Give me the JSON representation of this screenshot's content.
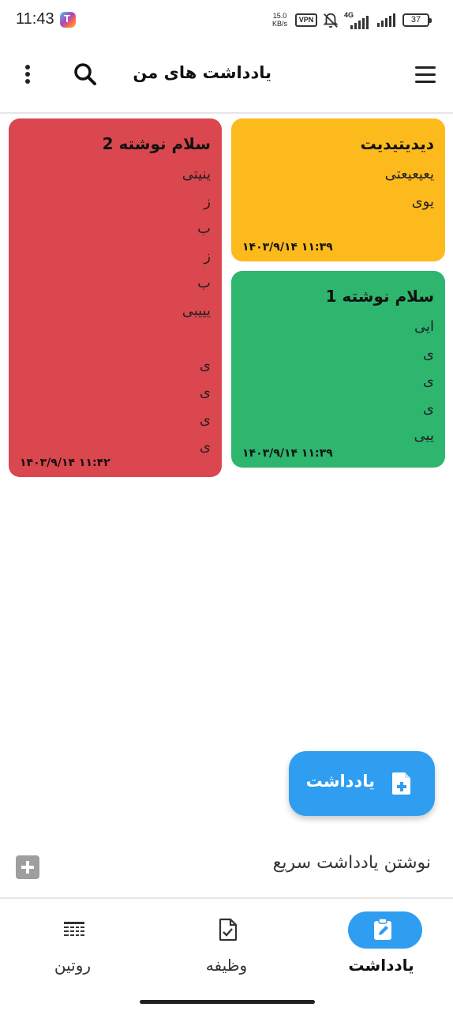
{
  "status_bar": {
    "time": "11:43",
    "net_speed_value": "15.0",
    "net_speed_unit": "KB/s",
    "vpn": "VPN",
    "network": "4G",
    "battery": "37"
  },
  "app_bar": {
    "title": "یادداشت های من",
    "icons": [
      "menu-icon",
      "search-icon",
      "more-vert-icon"
    ]
  },
  "notes": [
    {
      "title": "سلام نوشته 2",
      "lines": [
        "ینیتی",
        "ز",
        "ب",
        "ز",
        "ب",
        "یییبی",
        "",
        "ی",
        "ی",
        "ی",
        "ی"
      ],
      "date": "۱۴۰۳/۹/۱۴ ۱۱:۴۲",
      "color": "#db474e"
    },
    {
      "title": "دیدیتیدیت",
      "lines": [
        "یعیعیعتی",
        "یوی"
      ],
      "date": "۱۴۰۳/۹/۱۴ ۱۱:۳۹",
      "color": "#fdba1d"
    },
    {
      "title": "سلام نوشته 1",
      "lines": [
        "ایی",
        "ی",
        "ی",
        "ی",
        "ییی"
      ],
      "date": "۱۴۰۳/۹/۱۴ ۱۱:۳۹",
      "color": "#2eb66f"
    }
  ],
  "fab": {
    "label": "یادداشت",
    "icon": "note-add-icon",
    "color": "#2f9ef0"
  },
  "quick_note": {
    "placeholder": "نوشتن یادداشت سریع",
    "icon": "add-box-icon"
  },
  "bottom_nav": {
    "items": [
      {
        "label": "یادداشت",
        "icon": "edit-note-icon",
        "active": true
      },
      {
        "label": "وظیفه",
        "icon": "task-icon",
        "active": false
      },
      {
        "label": "روتین",
        "icon": "routine-icon",
        "active": false
      }
    ],
    "accent": "#2f9ef0"
  }
}
